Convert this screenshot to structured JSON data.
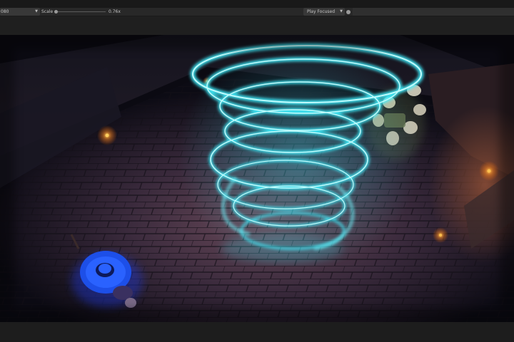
{
  "toolbar": {
    "resolution_label": "080",
    "scale_label": "Scale",
    "scale_value": "0.76x",
    "play_mode": "Play Focused"
  },
  "icons": {
    "dropdown_arrow": "chevron-down-icon",
    "play_toggle": "circle-toggle-icon"
  },
  "colors": {
    "tornado": "#38e8ff",
    "floor": "#4a3a48",
    "torch": "#ffaa33",
    "wizard_hat": "#1e5cff"
  }
}
